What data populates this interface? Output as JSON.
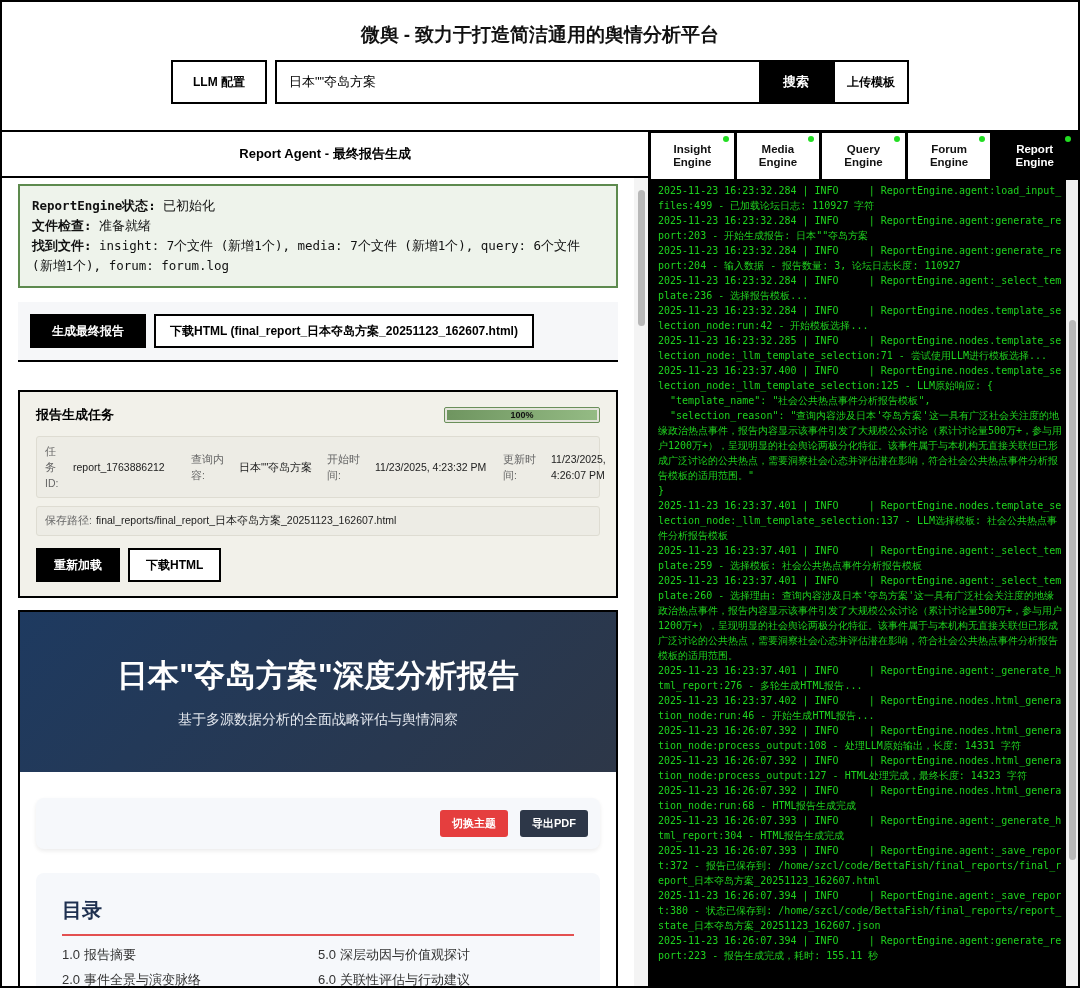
{
  "header": {
    "title": "微舆 - 致力于打造简洁通用的舆情分析平台",
    "llm_button": "LLM 配置",
    "search": {
      "value": "日本\"\"夺岛方案"
    },
    "search_button": "搜索",
    "upload_button": "上传模板"
  },
  "report_panel": {
    "title": "Report Agent - 最终报告生成",
    "status_lines": [
      "**ReportEngine状态:** 已初始化",
      "**文件检查:** 准备就绪",
      "**找到文件:** insight: 7个文件 (新增1个), media: 7个文件 (新增1个), query: 6个文件 (新增1个), forum: forum.log"
    ],
    "generate_button": "生成最终报告",
    "download_button": "下载HTML (final_report_日本夺岛方案_20251123_162607.html)",
    "task": {
      "title": "报告生成任务",
      "progress": {
        "level": 1,
        "label": "100%"
      },
      "fields": [
        {
          "label": "任务ID:",
          "value": "report_1763886212"
        },
        {
          "label": "查询内容:",
          "value": "日本\"\"夺岛方案"
        },
        {
          "label": "开始时间:",
          "value": "11/23/2025, 4:23:32 PM"
        },
        {
          "label": "更新时间:",
          "value": "11/23/2025, 4:26:07 PM"
        }
      ],
      "save_path": {
        "label": "保存路径:",
        "value": "final_reports/final_report_日本夺岛方案_20251123_162607.html"
      },
      "reload_button": "重新加载",
      "download_button": "下载HTML"
    },
    "preview": {
      "title": "日本\"夺岛方案\"深度分析报告",
      "subtitle": "基于多源数据分析的全面战略评估与舆情洞察",
      "theme_button": "切换主题",
      "pdf_button": "导出PDF",
      "toc": {
        "title": "目录",
        "items": [
          "1.0 报告摘要",
          "5.0 深层动因与价值观探讨",
          "2.0 事件全景与演变脉络",
          "6.0 关联性评估与行动建议"
        ]
      }
    }
  },
  "engine_tabs": [
    {
      "label": "Insight Engine",
      "selected": false,
      "on": true
    },
    {
      "label": "Media Engine",
      "selected": false,
      "on": true
    },
    {
      "label": "Query Engine",
      "selected": false,
      "on": true
    },
    {
      "label": "Forum Engine",
      "selected": false,
      "on": true
    },
    {
      "label": "Report Engine",
      "selected": true,
      "on": true
    }
  ],
  "log": [
    "2025-11-23 16:23:32.284 | INFO     | ReportEngine.agent:load_input_files:499 - 已加载论坛日志: 110927 字符",
    "2025-11-23 16:23:32.284 | INFO     | ReportEngine.agent:generate_report:203 - 开始生成报告: 日本\"\"夺岛方案",
    "2025-11-23 16:23:32.284 | INFO     | ReportEngine.agent:generate_report:204 - 输入数据 - 报告数量: 3, 论坛日志长度: 110927",
    "2025-11-23 16:23:32.284 | INFO     | ReportEngine.agent:_select_template:236 - 选择报告模板...",
    "2025-11-23 16:23:32.284 | INFO     | ReportEngine.nodes.template_selection_node:run:42 - 开始模板选择...",
    "2025-11-23 16:23:32.285 | INFO     | ReportEngine.nodes.template_selection_node:_llm_template_selection:71 - 尝试使用LLM进行模板选择...",
    "2025-11-23 16:23:37.400 | INFO     | ReportEngine.nodes.template_selection_node:_llm_template_selection:125 - LLM原始响应: {\n  \"template_name\": \"社会公共热点事件分析报告模板\",\n  \"selection_reason\": \"查询内容涉及日本'夺岛方案'这一具有广泛社会关注度的地缘政治热点事件，报告内容显示该事件引发了大规模公众讨论（累计讨论量500万+，参与用户1200万+），呈现明显的社会舆论两极分化特征。该事件属于与本机构无直接关联但已形成广泛讨论的公共热点，需要洞察社会心态并评估潜在影响，符合社会公共热点事件分析报告模板的适用范围。\"\n}",
    "2025-11-23 16:23:37.401 | INFO     | ReportEngine.nodes.template_selection_node:_llm_template_selection:137 - LLM选择模板: 社会公共热点事件分析报告模板",
    "2025-11-23 16:23:37.401 | INFO     | ReportEngine.agent:_select_template:259 - 选择模板: 社会公共热点事件分析报告模板",
    "2025-11-23 16:23:37.401 | INFO     | ReportEngine.agent:_select_template:260 - 选择理由: 查询内容涉及日本'夺岛方案'这一具有广泛社会关注度的地缘政治热点事件，报告内容显示该事件引发了大规模公众讨论（累计讨论量500万+，参与用户1200万+），呈现明显的社会舆论两极分化特征。该事件属于与本机构无直接关联但已形成广泛讨论的公共热点，需要洞察社会心态并评估潜在影响，符合社会公共热点事件分析报告模板的适用范围。",
    "2025-11-23 16:23:37.401 | INFO     | ReportEngine.agent:_generate_html_report:276 - 多轮生成HTML报告...",
    "2025-11-23 16:23:37.402 | INFO     | ReportEngine.nodes.html_generation_node:run:46 - 开始生成HTML报告...",
    "2025-11-23 16:26:07.392 | INFO     | ReportEngine.nodes.html_generation_node:process_output:108 - 处理LLM原始输出，长度: 14331 字符",
    "2025-11-23 16:26:07.392 | INFO     | ReportEngine.nodes.html_generation_node:process_output:127 - HTML处理完成，最终长度: 14323 字符",
    "2025-11-23 16:26:07.392 | INFO     | ReportEngine.nodes.html_generation_node:run:68 - HTML报告生成完成",
    "2025-11-23 16:26:07.393 | INFO     | ReportEngine.agent:_generate_html_report:304 - HTML报告生成完成",
    "2025-11-23 16:26:07.393 | INFO     | ReportEngine.agent:_save_report:372 - 报告已保存到: /home/szcl/code/BettaFish/final_reports/final_report_日本夺岛方案_20251123_162607.html",
    "2025-11-23 16:26:07.394 | INFO     | ReportEngine.agent:_save_report:380 - 状态已保存到: /home/szcl/code/BettaFish/final_reports/report_state_日本夺岛方案_20251123_162607.json",
    "2025-11-23 16:26:07.394 | INFO     | ReportEngine.agent:generate_report:223 - 报告生成完成，耗时: 155.11 秒"
  ]
}
